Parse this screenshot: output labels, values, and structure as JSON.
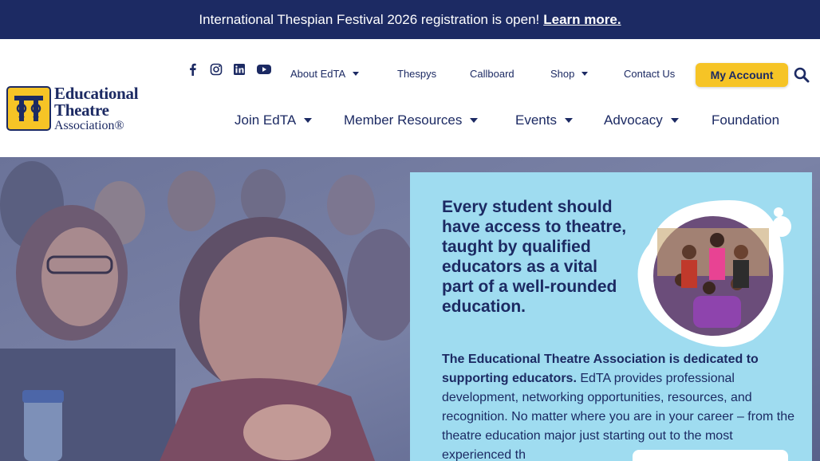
{
  "announcement": {
    "text": "International Thespian Festival 2026 registration is open!",
    "link": "Learn more."
  },
  "logo": {
    "line1": "Educational",
    "line2": "Theatre",
    "line3": "Association®"
  },
  "social_icons": [
    "facebook-icon",
    "instagram-icon",
    "linkedin-icon",
    "youtube-icon"
  ],
  "top_nav": {
    "about": "About EdTA",
    "thespys": "Thespys",
    "callboard": "Callboard",
    "shop": "Shop",
    "contact": "Contact Us"
  },
  "account_button": "My Account",
  "main_nav": {
    "join": "Join EdTA",
    "member_resources": "Member Resources",
    "events": "Events",
    "advocacy": "Advocacy",
    "foundation": "Foundation"
  },
  "hero": {
    "headline": "Every student should have access to theatre, taught by qualified educators as a vital part of a well-rounded education.",
    "body_bold": "The Educational Theatre Association is dedicated to supporting educators.",
    "body_text": " EdTA provides professional development, networking opportunities, resources, and recognition. No matter where you are in your career – from the theatre education major just starting out to the most experienced th"
  },
  "colors": {
    "navy": "#1c2a63",
    "gold": "#f6c426",
    "card_blue": "#9fdcf0"
  }
}
